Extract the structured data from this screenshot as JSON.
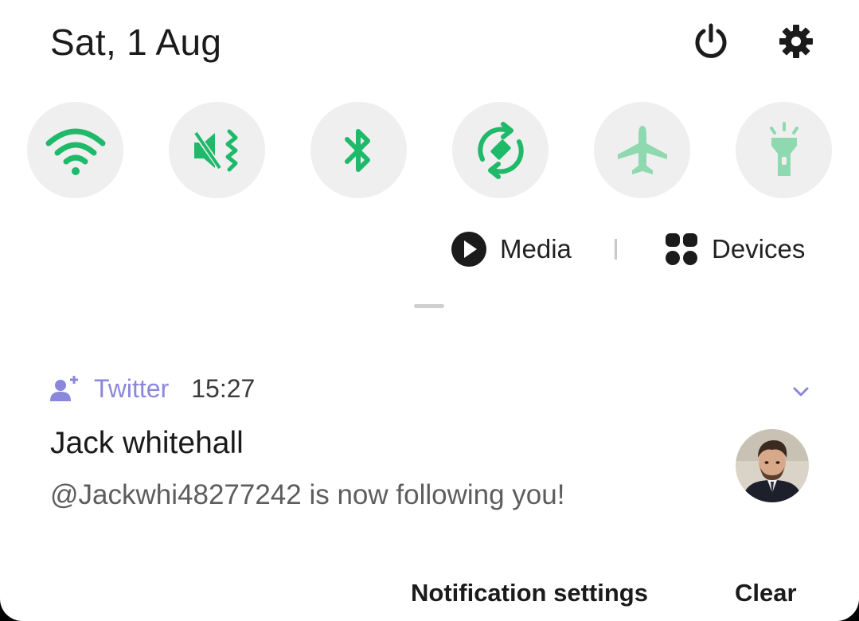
{
  "header": {
    "date": "Sat, 1 Aug",
    "power_icon": "power-icon",
    "settings_icon": "gear-icon"
  },
  "quick_settings": [
    {
      "name": "wifi",
      "icon": "wifi-icon",
      "active": true
    },
    {
      "name": "mute-vibrate",
      "icon": "vibrate-mute-icon",
      "active": true
    },
    {
      "name": "bluetooth",
      "icon": "bluetooth-icon",
      "active": true
    },
    {
      "name": "auto-rotate",
      "icon": "auto-rotate-icon",
      "active": true
    },
    {
      "name": "airplane-mode",
      "icon": "airplane-icon",
      "active": false
    },
    {
      "name": "flashlight",
      "icon": "flashlight-icon",
      "active": false
    }
  ],
  "media_bar": {
    "media_label": "Media",
    "devices_label": "Devices"
  },
  "notification": {
    "app_icon": "add-person-icon",
    "app_name": "Twitter",
    "time": "15:27",
    "title": "Jack whitehall",
    "body": "@Jackwhi48277242 is now following you!",
    "expand_icon": "chevron-down-icon"
  },
  "actions": {
    "settings_label": "Notification settings",
    "clear_label": "Clear"
  },
  "colors": {
    "active_green": "#1fb96a",
    "inactive_green": "#8fd9b0",
    "twitter_purple": "#8a87dc",
    "tile_bg": "#efefef"
  }
}
